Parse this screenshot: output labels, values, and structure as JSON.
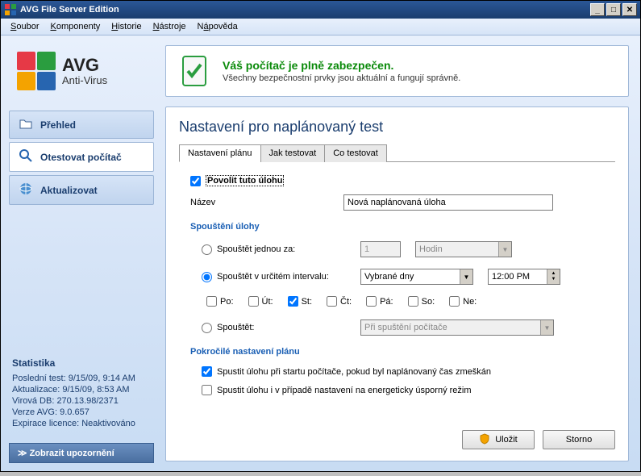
{
  "window": {
    "title": "AVG File Server Edition"
  },
  "menu": {
    "items": [
      {
        "label": "Soubor",
        "u": "S"
      },
      {
        "label": "Komponenty",
        "u": "K"
      },
      {
        "label": "Historie",
        "u": "H"
      },
      {
        "label": "Nástroje",
        "u": "N"
      },
      {
        "label": "Nápověda",
        "u": "á"
      }
    ]
  },
  "logo": {
    "name": "AVG",
    "sub": "Anti-Virus"
  },
  "nav": {
    "overview": "Přehled",
    "scan": "Otestovat počítač",
    "update": "Aktualizovat"
  },
  "stats": {
    "title": "Statistika",
    "last_scan_label": "Poslední test:",
    "last_scan": "9/15/09, 9:14 AM",
    "update_label": "Aktualizace:",
    "update": "9/15/09, 8:53 AM",
    "db_label": "Virová DB:",
    "db": "270.13.98/2371",
    "ver_label": "Verze AVG:",
    "ver": "9.0.657",
    "lic_label": "Expirace licence:",
    "lic": "Neaktivováno"
  },
  "show_notifications": "Zobrazit upozornění",
  "status": {
    "title": "Váš počítač je plně zabezpečen.",
    "sub": "Všechny bezpečnostní prvky jsou aktuální a fungují správně."
  },
  "panel": {
    "title": "Nastavení pro naplánovaný test",
    "tabs": [
      "Nastavení plánu",
      "Jak testovat",
      "Co testovat"
    ],
    "enable_label": "Povolit tuto úlohu",
    "enable_checked": true,
    "name_label": "Název",
    "name_value": "Nová naplánovaná úloha",
    "schedule_heading": "Spouštění úlohy",
    "run_every_label": "Spouštět jednou za:",
    "run_every_value": "1",
    "run_every_unit": "Hodin",
    "run_interval_label": "Spouštět v určitém intervalu:",
    "run_interval_value": "Vybrané dny",
    "run_interval_time": "12:00 PM",
    "run_on_label": "Spouštět:",
    "run_on_value": "Při spuštění počítače",
    "days": {
      "mon": "Po:",
      "tue": "Út:",
      "wed": "St:",
      "thu": "Čt:",
      "fri": "Pá:",
      "sat": "So:",
      "sun": "Ne:"
    },
    "days_checked": {
      "wed": true
    },
    "advanced_heading": "Pokročilé nastavení plánu",
    "adv1": "Spustit úlohu při startu počítače, pokud byl naplánovaný čas zmeškán",
    "adv1_checked": true,
    "adv2": "Spustit úlohu i v případě nastavení na energeticky úsporný režim",
    "adv2_checked": false
  },
  "buttons": {
    "save": "Uložit",
    "cancel": "Storno"
  }
}
